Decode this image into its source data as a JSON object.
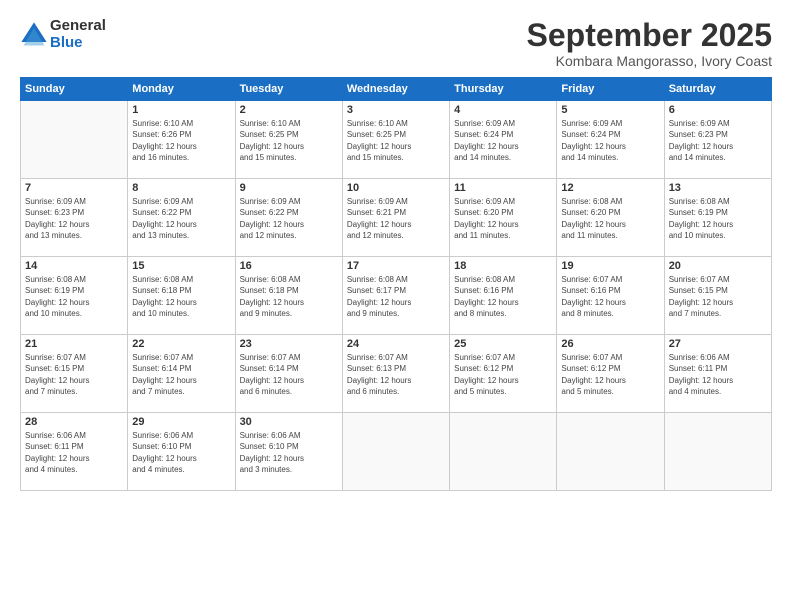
{
  "logo": {
    "general": "General",
    "blue": "Blue"
  },
  "title": "September 2025",
  "subtitle": "Kombara Mangorasso, Ivory Coast",
  "days_of_week": [
    "Sunday",
    "Monday",
    "Tuesday",
    "Wednesday",
    "Thursday",
    "Friday",
    "Saturday"
  ],
  "weeks": [
    [
      {
        "day": "",
        "info": ""
      },
      {
        "day": "1",
        "info": "Sunrise: 6:10 AM\nSunset: 6:26 PM\nDaylight: 12 hours\nand 16 minutes."
      },
      {
        "day": "2",
        "info": "Sunrise: 6:10 AM\nSunset: 6:25 PM\nDaylight: 12 hours\nand 15 minutes."
      },
      {
        "day": "3",
        "info": "Sunrise: 6:10 AM\nSunset: 6:25 PM\nDaylight: 12 hours\nand 15 minutes."
      },
      {
        "day": "4",
        "info": "Sunrise: 6:09 AM\nSunset: 6:24 PM\nDaylight: 12 hours\nand 14 minutes."
      },
      {
        "day": "5",
        "info": "Sunrise: 6:09 AM\nSunset: 6:24 PM\nDaylight: 12 hours\nand 14 minutes."
      },
      {
        "day": "6",
        "info": "Sunrise: 6:09 AM\nSunset: 6:23 PM\nDaylight: 12 hours\nand 14 minutes."
      }
    ],
    [
      {
        "day": "7",
        "info": "Sunrise: 6:09 AM\nSunset: 6:23 PM\nDaylight: 12 hours\nand 13 minutes."
      },
      {
        "day": "8",
        "info": "Sunrise: 6:09 AM\nSunset: 6:22 PM\nDaylight: 12 hours\nand 13 minutes."
      },
      {
        "day": "9",
        "info": "Sunrise: 6:09 AM\nSunset: 6:22 PM\nDaylight: 12 hours\nand 12 minutes."
      },
      {
        "day": "10",
        "info": "Sunrise: 6:09 AM\nSunset: 6:21 PM\nDaylight: 12 hours\nand 12 minutes."
      },
      {
        "day": "11",
        "info": "Sunrise: 6:09 AM\nSunset: 6:20 PM\nDaylight: 12 hours\nand 11 minutes."
      },
      {
        "day": "12",
        "info": "Sunrise: 6:08 AM\nSunset: 6:20 PM\nDaylight: 12 hours\nand 11 minutes."
      },
      {
        "day": "13",
        "info": "Sunrise: 6:08 AM\nSunset: 6:19 PM\nDaylight: 12 hours\nand 10 minutes."
      }
    ],
    [
      {
        "day": "14",
        "info": "Sunrise: 6:08 AM\nSunset: 6:19 PM\nDaylight: 12 hours\nand 10 minutes."
      },
      {
        "day": "15",
        "info": "Sunrise: 6:08 AM\nSunset: 6:18 PM\nDaylight: 12 hours\nand 10 minutes."
      },
      {
        "day": "16",
        "info": "Sunrise: 6:08 AM\nSunset: 6:18 PM\nDaylight: 12 hours\nand 9 minutes."
      },
      {
        "day": "17",
        "info": "Sunrise: 6:08 AM\nSunset: 6:17 PM\nDaylight: 12 hours\nand 9 minutes."
      },
      {
        "day": "18",
        "info": "Sunrise: 6:08 AM\nSunset: 6:16 PM\nDaylight: 12 hours\nand 8 minutes."
      },
      {
        "day": "19",
        "info": "Sunrise: 6:07 AM\nSunset: 6:16 PM\nDaylight: 12 hours\nand 8 minutes."
      },
      {
        "day": "20",
        "info": "Sunrise: 6:07 AM\nSunset: 6:15 PM\nDaylight: 12 hours\nand 7 minutes."
      }
    ],
    [
      {
        "day": "21",
        "info": "Sunrise: 6:07 AM\nSunset: 6:15 PM\nDaylight: 12 hours\nand 7 minutes."
      },
      {
        "day": "22",
        "info": "Sunrise: 6:07 AM\nSunset: 6:14 PM\nDaylight: 12 hours\nand 7 minutes."
      },
      {
        "day": "23",
        "info": "Sunrise: 6:07 AM\nSunset: 6:14 PM\nDaylight: 12 hours\nand 6 minutes."
      },
      {
        "day": "24",
        "info": "Sunrise: 6:07 AM\nSunset: 6:13 PM\nDaylight: 12 hours\nand 6 minutes."
      },
      {
        "day": "25",
        "info": "Sunrise: 6:07 AM\nSunset: 6:12 PM\nDaylight: 12 hours\nand 5 minutes."
      },
      {
        "day": "26",
        "info": "Sunrise: 6:07 AM\nSunset: 6:12 PM\nDaylight: 12 hours\nand 5 minutes."
      },
      {
        "day": "27",
        "info": "Sunrise: 6:06 AM\nSunset: 6:11 PM\nDaylight: 12 hours\nand 4 minutes."
      }
    ],
    [
      {
        "day": "28",
        "info": "Sunrise: 6:06 AM\nSunset: 6:11 PM\nDaylight: 12 hours\nand 4 minutes."
      },
      {
        "day": "29",
        "info": "Sunrise: 6:06 AM\nSunset: 6:10 PM\nDaylight: 12 hours\nand 4 minutes."
      },
      {
        "day": "30",
        "info": "Sunrise: 6:06 AM\nSunset: 6:10 PM\nDaylight: 12 hours\nand 3 minutes."
      },
      {
        "day": "",
        "info": ""
      },
      {
        "day": "",
        "info": ""
      },
      {
        "day": "",
        "info": ""
      },
      {
        "day": "",
        "info": ""
      }
    ]
  ]
}
